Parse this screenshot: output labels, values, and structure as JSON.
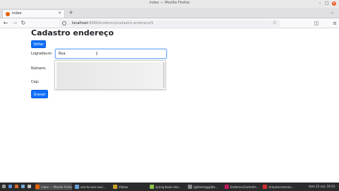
{
  "window": {
    "title": "index — Mozilla Firefox"
  },
  "tab": {
    "label": "index"
  },
  "urlbar": {
    "host": "localhost",
    "path": ":8080/endereco/cadastro-endereco/5"
  },
  "page": {
    "title": "Cadastro endereço",
    "voltar_label": "Voltar",
    "gravar_label": "Gravar",
    "fields": {
      "logradouro_label": "Logradouro:",
      "logradouro_value": "Rua",
      "numero_label": "Número:",
      "cep_label": "Cep:"
    }
  },
  "taskbar": {
    "items": [
      {
        "label": "index — Mozilla Firefox",
        "color": "#e66000"
      },
      {
        "label": "one-to-one-soul...",
        "color": "#6a9fd4"
      },
      {
        "label": "Vídeos",
        "color": "#c9a227"
      },
      {
        "label": "spring-book-rela...",
        "color": "#8bc34a"
      },
      {
        "label": "[gilberto@gilbe...",
        "color": "#888888"
      },
      {
        "label": "EnderecoControlle...",
        "color": "#c2185b"
      },
      {
        "label": "simplescreenrec...",
        "color": "#d32f2f"
      }
    ],
    "clock": "dom 22 out, 19:33"
  },
  "colors": {
    "primary_button": "#0d6efd",
    "close_button": "#e95420"
  }
}
